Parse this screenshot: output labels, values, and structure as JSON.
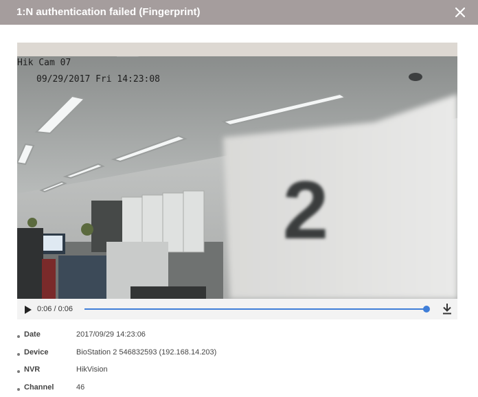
{
  "dialog": {
    "title": "1:N authentication failed (Fingerprint)",
    "close_icon": "close-icon"
  },
  "video": {
    "overlay_camera": "Hik Cam 07",
    "overlay_timestamp": "09/29/2017 Fri 14:23:08",
    "card_text": "2",
    "time_display": "0:06 / 0:06",
    "progress": 1.0,
    "play_icon": "play-icon",
    "download_icon": "download-icon",
    "accent_color": "#3f7ed8"
  },
  "details": [
    {
      "label": "Date",
      "value": "2017/09/29 14:23:06"
    },
    {
      "label": "Device",
      "value": "BioStation 2 546832593 (192.168.14.203)"
    },
    {
      "label": "NVR",
      "value": "HikVision"
    },
    {
      "label": "Channel",
      "value": "46"
    }
  ]
}
